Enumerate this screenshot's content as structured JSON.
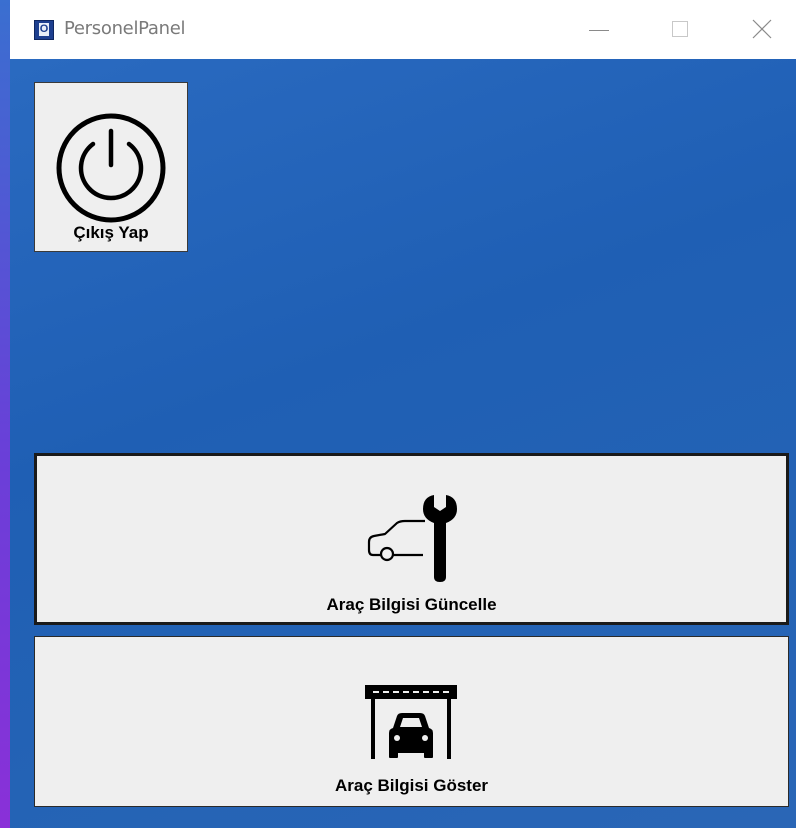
{
  "window": {
    "title": "PersonelPanel",
    "app_icon_letter": "O"
  },
  "buttons": {
    "logout": {
      "label": "Çıkış Yap",
      "icon": "power-icon"
    },
    "update_vehicle": {
      "label": "Araç Bilgisi Güncelle",
      "icon": "car-wrench-icon"
    },
    "show_vehicle": {
      "label": "Araç Bilgisi Göster",
      "icon": "car-garage-icon"
    }
  },
  "colors": {
    "background": "#1f5fb4",
    "button_face": "#efefef",
    "titlebar": "#ffffff"
  }
}
